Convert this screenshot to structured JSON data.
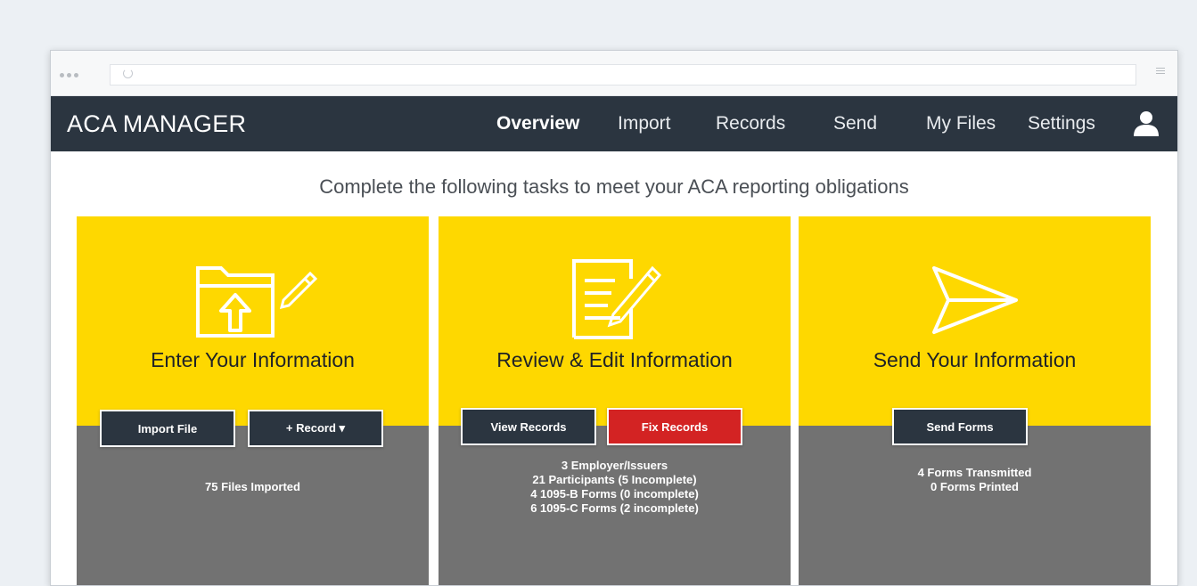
{
  "app": {
    "title": "ACA MANAGER",
    "nav": [
      {
        "label": "Overview",
        "active": true
      },
      {
        "label": "Import",
        "active": false
      },
      {
        "label": "Records",
        "active": false
      },
      {
        "label": "Send",
        "active": false
      },
      {
        "label": "My Files",
        "active": false
      },
      {
        "label": "Settings",
        "active": false
      }
    ],
    "user_icon": "user-icon"
  },
  "intro": "Complete the following tasks to meet your ACA reporting obligations",
  "cards": [
    {
      "icon": "folder-upload-pencil-icon",
      "title": "Enter Your Information",
      "buttons": [
        "Import File",
        "+ Record ▾"
      ],
      "stats": [
        "75 Files Imported"
      ]
    },
    {
      "icon": "document-edit-icon",
      "title": "Review & Edit Information",
      "buttons": [
        "View Records",
        "Fix Records"
      ],
      "stats": [
        "3 Employer/Issuers",
        "21 Participants (5 Incomplete)",
        "4 1095-B Forms (0 incomplete)",
        "6 1095-C Forms (2 incomplete)"
      ]
    },
    {
      "icon": "paper-plane-icon",
      "title": "Send Your Information",
      "buttons": [
        "Send Forms"
      ],
      "stats": [
        "4 Forms Transmitted",
        "0 Forms Printed"
      ]
    }
  ],
  "colors": {
    "navbar": "#2b3540",
    "card_top": "#fed800",
    "card_bottom": "#727272",
    "danger_button": "#d32323"
  }
}
